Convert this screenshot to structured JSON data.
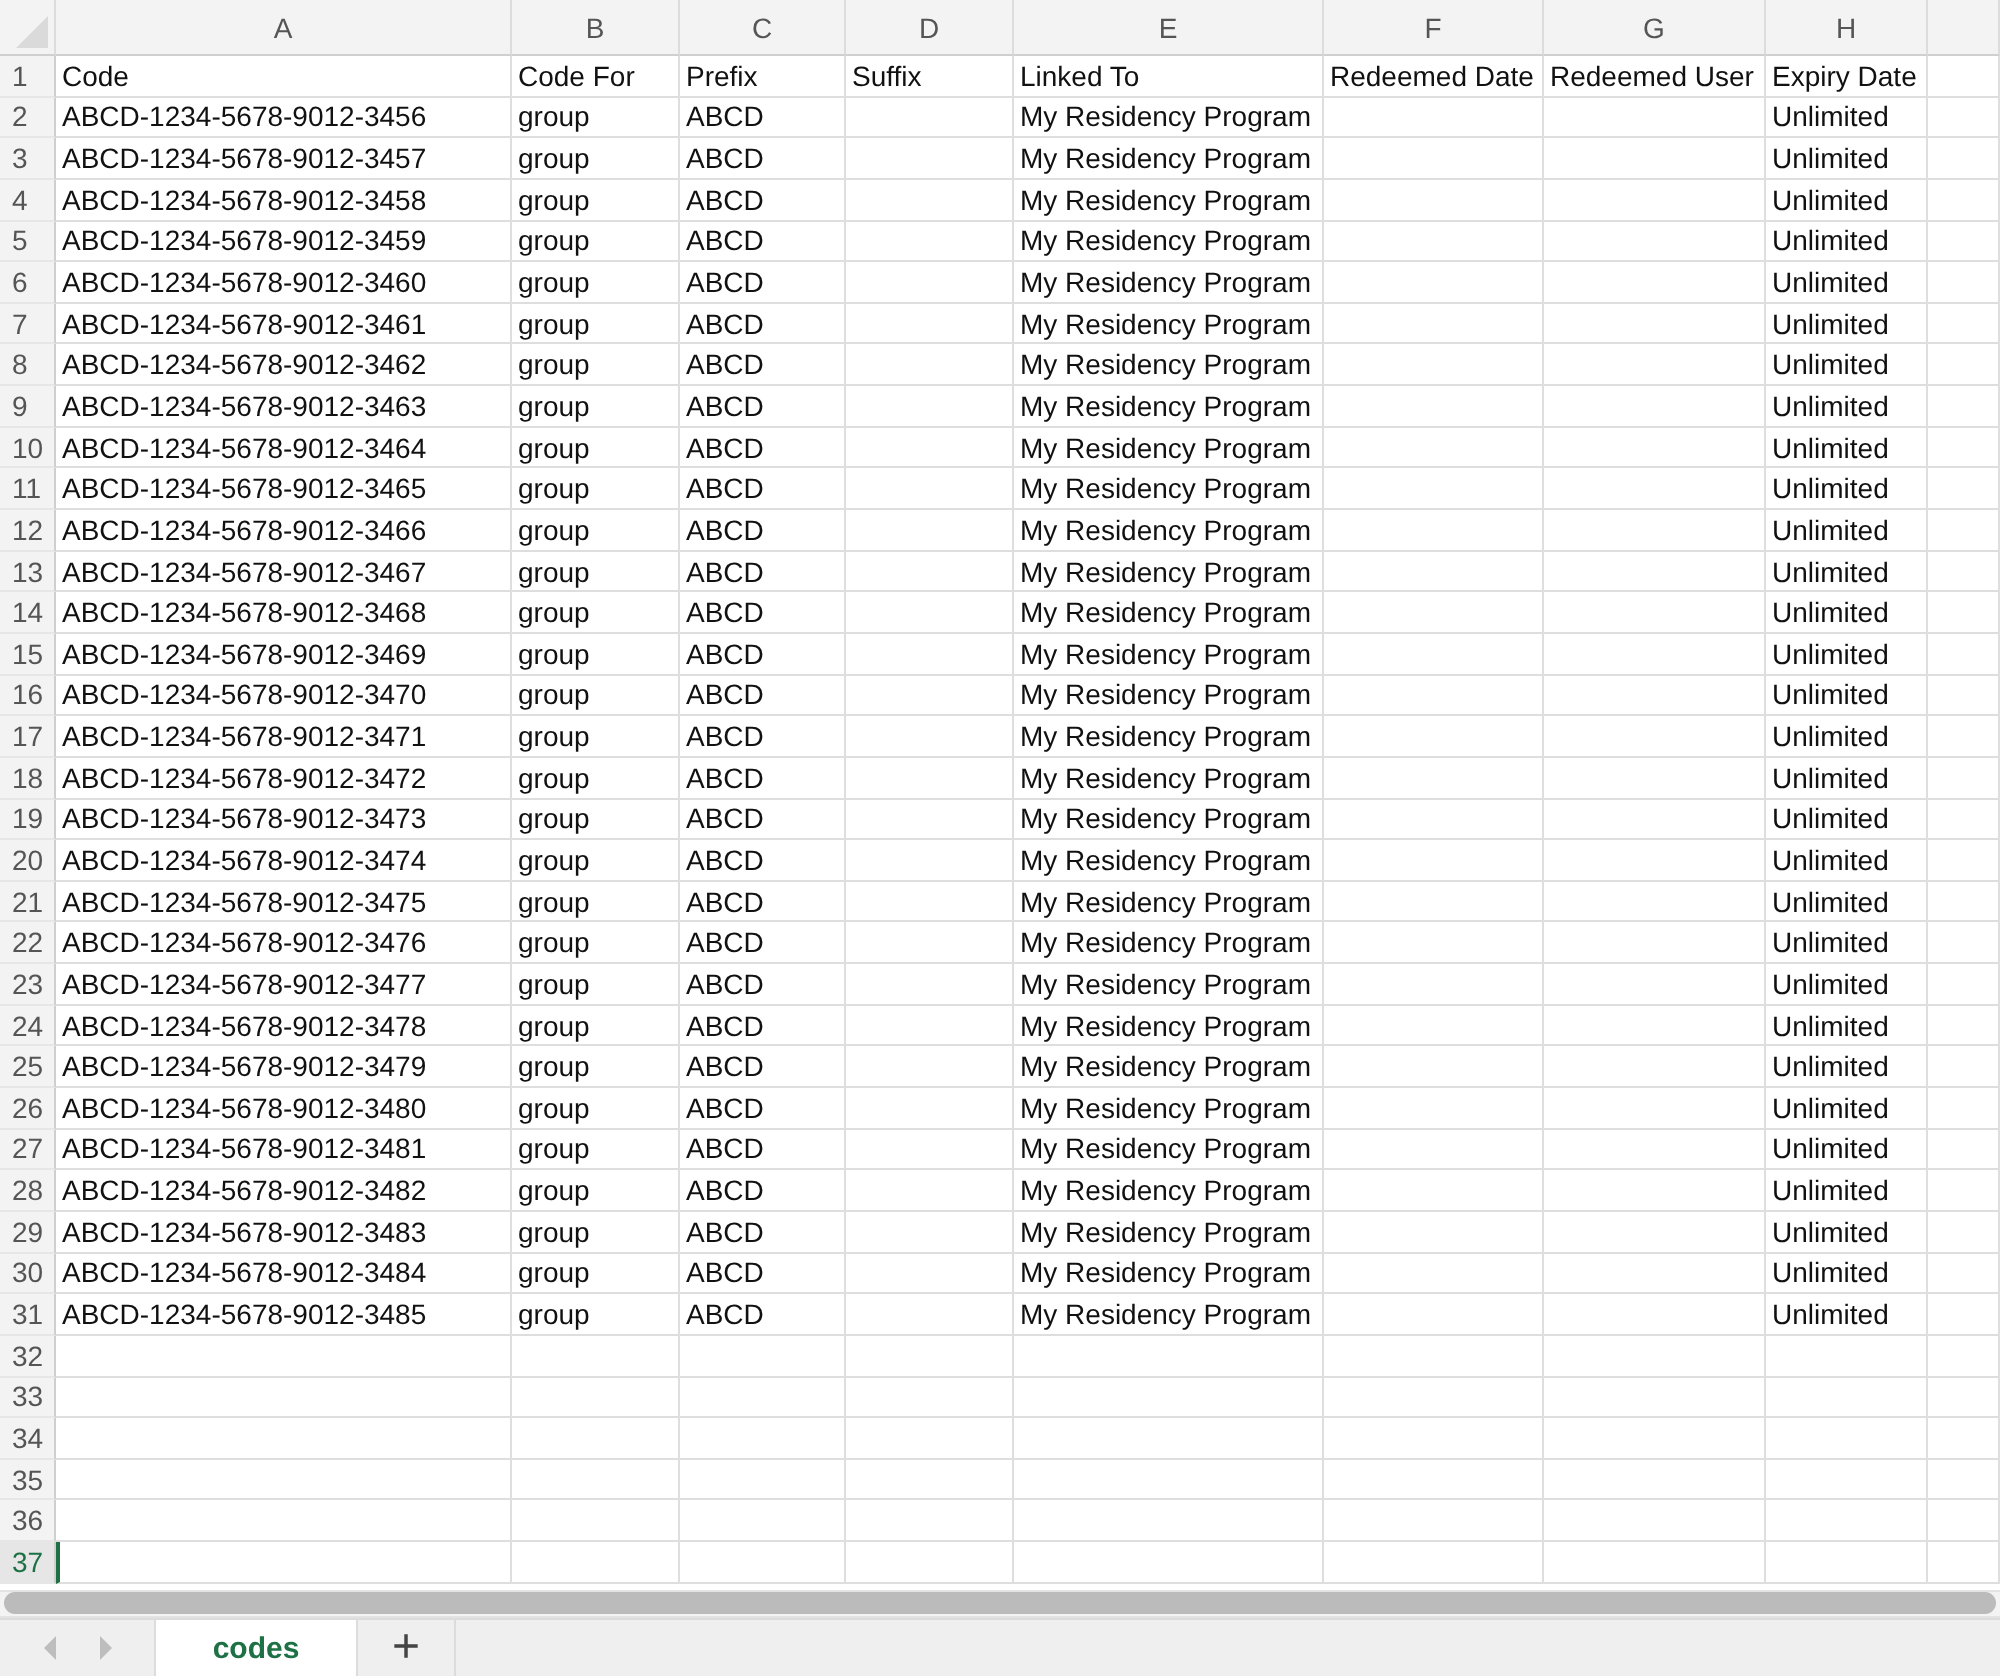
{
  "columns": [
    {
      "label": "A",
      "selected": false
    },
    {
      "label": "B",
      "selected": false
    },
    {
      "label": "C",
      "selected": false
    },
    {
      "label": "D",
      "selected": false
    },
    {
      "label": "E",
      "selected": false
    },
    {
      "label": "F",
      "selected": false
    },
    {
      "label": "G",
      "selected": false
    },
    {
      "label": "H",
      "selected": false
    }
  ],
  "rows": [
    {
      "number": "1",
      "selected": false,
      "cells": [
        "Code",
        "Code For",
        "Prefix",
        "Suffix",
        "Linked To",
        "Redeemed Date",
        "Redeemed User",
        "Expiry Date"
      ]
    },
    {
      "number": "2",
      "selected": false,
      "cells": [
        "ABCD-1234-5678-9012-3456",
        "group",
        "ABCD",
        null,
        "My Residency Program",
        null,
        null,
        "Unlimited"
      ]
    },
    {
      "number": "3",
      "selected": false,
      "cells": [
        "ABCD-1234-5678-9012-3457",
        "group",
        "ABCD",
        null,
        "My Residency Program",
        null,
        null,
        "Unlimited"
      ]
    },
    {
      "number": "4",
      "selected": false,
      "cells": [
        "ABCD-1234-5678-9012-3458",
        "group",
        "ABCD",
        null,
        "My Residency Program",
        null,
        null,
        "Unlimited"
      ]
    },
    {
      "number": "5",
      "selected": false,
      "cells": [
        "ABCD-1234-5678-9012-3459",
        "group",
        "ABCD",
        null,
        "My Residency Program",
        null,
        null,
        "Unlimited"
      ]
    },
    {
      "number": "6",
      "selected": false,
      "cells": [
        "ABCD-1234-5678-9012-3460",
        "group",
        "ABCD",
        null,
        "My Residency Program",
        null,
        null,
        "Unlimited"
      ]
    },
    {
      "number": "7",
      "selected": false,
      "cells": [
        "ABCD-1234-5678-9012-3461",
        "group",
        "ABCD",
        null,
        "My Residency Program",
        null,
        null,
        "Unlimited"
      ]
    },
    {
      "number": "8",
      "selected": false,
      "cells": [
        "ABCD-1234-5678-9012-3462",
        "group",
        "ABCD",
        null,
        "My Residency Program",
        null,
        null,
        "Unlimited"
      ]
    },
    {
      "number": "9",
      "selected": false,
      "cells": [
        "ABCD-1234-5678-9012-3463",
        "group",
        "ABCD",
        null,
        "My Residency Program",
        null,
        null,
        "Unlimited"
      ]
    },
    {
      "number": "10",
      "selected": false,
      "cells": [
        "ABCD-1234-5678-9012-3464",
        "group",
        "ABCD",
        null,
        "My Residency Program",
        null,
        null,
        "Unlimited"
      ]
    },
    {
      "number": "11",
      "selected": false,
      "cells": [
        "ABCD-1234-5678-9012-3465",
        "group",
        "ABCD",
        null,
        "My Residency Program",
        null,
        null,
        "Unlimited"
      ]
    },
    {
      "number": "12",
      "selected": false,
      "cells": [
        "ABCD-1234-5678-9012-3466",
        "group",
        "ABCD",
        null,
        "My Residency Program",
        null,
        null,
        "Unlimited"
      ]
    },
    {
      "number": "13",
      "selected": false,
      "cells": [
        "ABCD-1234-5678-9012-3467",
        "group",
        "ABCD",
        null,
        "My Residency Program",
        null,
        null,
        "Unlimited"
      ]
    },
    {
      "number": "14",
      "selected": false,
      "cells": [
        "ABCD-1234-5678-9012-3468",
        "group",
        "ABCD",
        null,
        "My Residency Program",
        null,
        null,
        "Unlimited"
      ]
    },
    {
      "number": "15",
      "selected": false,
      "cells": [
        "ABCD-1234-5678-9012-3469",
        "group",
        "ABCD",
        null,
        "My Residency Program",
        null,
        null,
        "Unlimited"
      ]
    },
    {
      "number": "16",
      "selected": false,
      "cells": [
        "ABCD-1234-5678-9012-3470",
        "group",
        "ABCD",
        null,
        "My Residency Program",
        null,
        null,
        "Unlimited"
      ]
    },
    {
      "number": "17",
      "selected": false,
      "cells": [
        "ABCD-1234-5678-9012-3471",
        "group",
        "ABCD",
        null,
        "My Residency Program",
        null,
        null,
        "Unlimited"
      ]
    },
    {
      "number": "18",
      "selected": false,
      "cells": [
        "ABCD-1234-5678-9012-3472",
        "group",
        "ABCD",
        null,
        "My Residency Program",
        null,
        null,
        "Unlimited"
      ]
    },
    {
      "number": "19",
      "selected": false,
      "cells": [
        "ABCD-1234-5678-9012-3473",
        "group",
        "ABCD",
        null,
        "My Residency Program",
        null,
        null,
        "Unlimited"
      ]
    },
    {
      "number": "20",
      "selected": false,
      "cells": [
        "ABCD-1234-5678-9012-3474",
        "group",
        "ABCD",
        null,
        "My Residency Program",
        null,
        null,
        "Unlimited"
      ]
    },
    {
      "number": "21",
      "selected": false,
      "cells": [
        "ABCD-1234-5678-9012-3475",
        "group",
        "ABCD",
        null,
        "My Residency Program",
        null,
        null,
        "Unlimited"
      ]
    },
    {
      "number": "22",
      "selected": false,
      "cells": [
        "ABCD-1234-5678-9012-3476",
        "group",
        "ABCD",
        null,
        "My Residency Program",
        null,
        null,
        "Unlimited"
      ]
    },
    {
      "number": "23",
      "selected": false,
      "cells": [
        "ABCD-1234-5678-9012-3477",
        "group",
        "ABCD",
        null,
        "My Residency Program",
        null,
        null,
        "Unlimited"
      ]
    },
    {
      "number": "24",
      "selected": false,
      "cells": [
        "ABCD-1234-5678-9012-3478",
        "group",
        "ABCD",
        null,
        "My Residency Program",
        null,
        null,
        "Unlimited"
      ]
    },
    {
      "number": "25",
      "selected": false,
      "cells": [
        "ABCD-1234-5678-9012-3479",
        "group",
        "ABCD",
        null,
        "My Residency Program",
        null,
        null,
        "Unlimited"
      ]
    },
    {
      "number": "26",
      "selected": false,
      "cells": [
        "ABCD-1234-5678-9012-3480",
        "group",
        "ABCD",
        null,
        "My Residency Program",
        null,
        null,
        "Unlimited"
      ]
    },
    {
      "number": "27",
      "selected": false,
      "cells": [
        "ABCD-1234-5678-9012-3481",
        "group",
        "ABCD",
        null,
        "My Residency Program",
        null,
        null,
        "Unlimited"
      ]
    },
    {
      "number": "28",
      "selected": false,
      "cells": [
        "ABCD-1234-5678-9012-3482",
        "group",
        "ABCD",
        null,
        "My Residency Program",
        null,
        null,
        "Unlimited"
      ]
    },
    {
      "number": "29",
      "selected": false,
      "cells": [
        "ABCD-1234-5678-9012-3483",
        "group",
        "ABCD",
        null,
        "My Residency Program",
        null,
        null,
        "Unlimited"
      ]
    },
    {
      "number": "30",
      "selected": false,
      "cells": [
        "ABCD-1234-5678-9012-3484",
        "group",
        "ABCD",
        null,
        "My Residency Program",
        null,
        null,
        "Unlimited"
      ]
    },
    {
      "number": "31",
      "selected": false,
      "cells": [
        "ABCD-1234-5678-9012-3485",
        "group",
        "ABCD",
        null,
        "My Residency Program",
        null,
        null,
        "Unlimited"
      ]
    },
    {
      "number": "32",
      "selected": false,
      "cells": []
    },
    {
      "number": "33",
      "selected": false,
      "cells": []
    },
    {
      "number": "34",
      "selected": false,
      "cells": []
    },
    {
      "number": "35",
      "selected": false,
      "cells": []
    },
    {
      "number": "36",
      "selected": false,
      "cells": []
    },
    {
      "number": "37",
      "selected": true,
      "cells": []
    }
  ],
  "sheet_tabs": [
    {
      "label": "codes",
      "selected": true
    }
  ],
  "add_sheet": {
    "label": "+"
  }
}
